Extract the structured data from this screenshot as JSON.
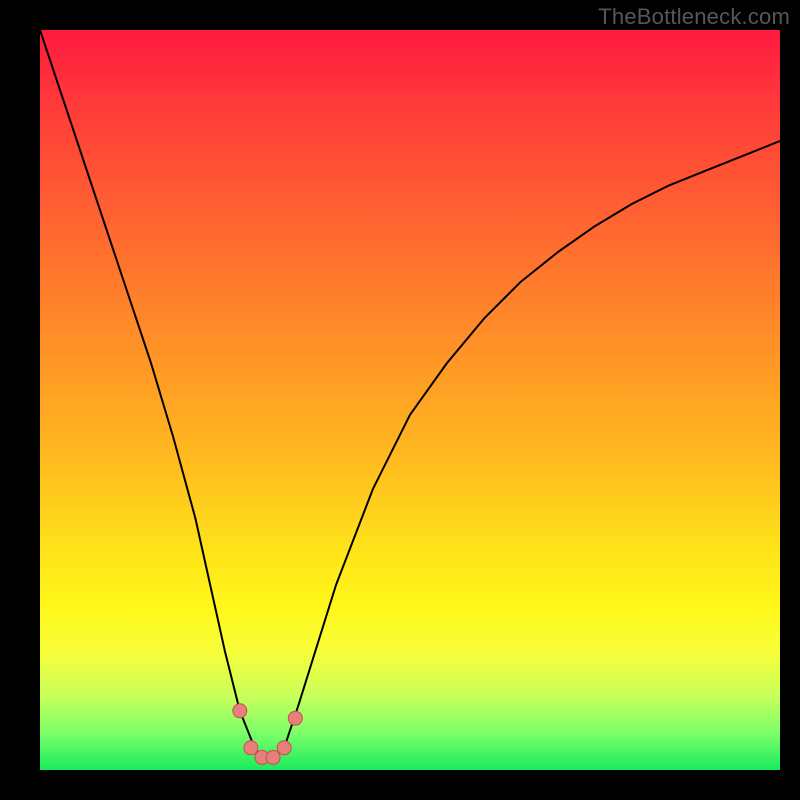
{
  "watermark": "TheBottleneck.com",
  "colors": {
    "curve": "#000000",
    "markers_fill": "#e77f7b",
    "markers_stroke": "#c94f4b",
    "gradient_top": "#ff1a3f",
    "gradient_bottom": "#19eb5c",
    "frame": "#000000"
  },
  "chart_data": {
    "type": "line",
    "title": "",
    "xlabel": "",
    "ylabel": "",
    "xlim": [
      0,
      100
    ],
    "ylim": [
      0,
      100
    ],
    "grid": false,
    "legend": "",
    "series": [
      {
        "name": "bottleneck-curve",
        "x": [
          0,
          5,
          10,
          15,
          18,
          21,
          23,
          25,
          27,
          29,
          30,
          31.5,
          33,
          35,
          40,
          45,
          50,
          55,
          60,
          65,
          70,
          75,
          80,
          85,
          90,
          95,
          100
        ],
        "values": [
          100,
          85,
          70,
          55,
          45,
          34,
          25,
          16,
          8,
          3,
          1.5,
          1.5,
          3,
          9,
          25,
          38,
          48,
          55,
          61,
          66,
          70,
          73.5,
          76.5,
          79,
          81,
          83,
          85
        ]
      },
      {
        "name": "markers",
        "x": [
          27,
          28.5,
          30,
          31.5,
          33,
          34.5
        ],
        "values": [
          8,
          3,
          1.7,
          1.7,
          3,
          7
        ]
      }
    ]
  }
}
